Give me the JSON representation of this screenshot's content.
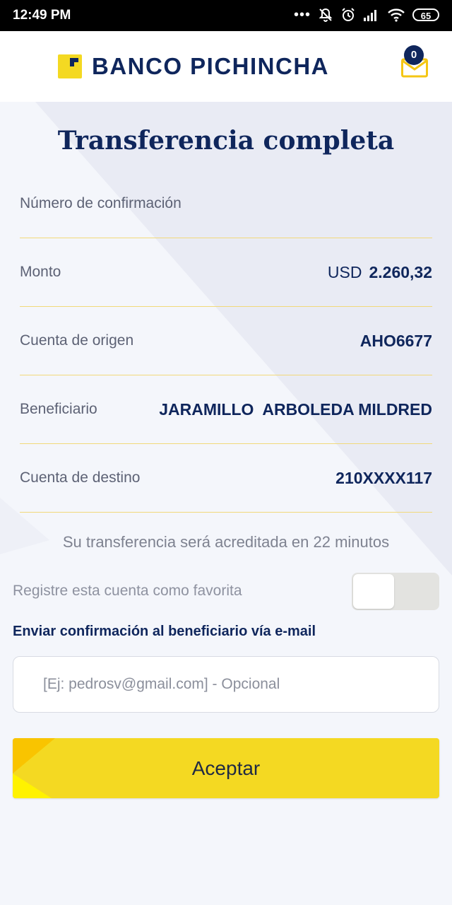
{
  "status_bar": {
    "time": "12:49 PM",
    "dots": "•••",
    "battery": "65"
  },
  "header": {
    "brand": "BANCO PICHINCHA",
    "messages_count": "0"
  },
  "main": {
    "title": "Transferencia completa",
    "details": [
      {
        "label": "Número de confirmación",
        "value": ""
      },
      {
        "label": "Monto",
        "currency": "USD",
        "value": "2.260,32"
      },
      {
        "label": "Cuenta de origen",
        "value": "AHO6677"
      },
      {
        "label": "Beneficiario",
        "value": "JARAMILLO  ARBOLEDA MILDRED"
      },
      {
        "label": "Cuenta de destino",
        "value": "210XXXX117"
      }
    ],
    "info_text": "Su transferencia será acreditada en 22 minutos",
    "favorite_label": "Registre esta cuenta como favorita",
    "email_label": "Enviar confirmación al beneficiario vía e-mail",
    "email_placeholder": "[Ej: pedrosv@gmail.com] - Opcional",
    "accept_label": "Aceptar"
  },
  "colors": {
    "brand_navy": "#0f265c",
    "brand_yellow": "#f4d922",
    "divider": "#f1d97a"
  }
}
